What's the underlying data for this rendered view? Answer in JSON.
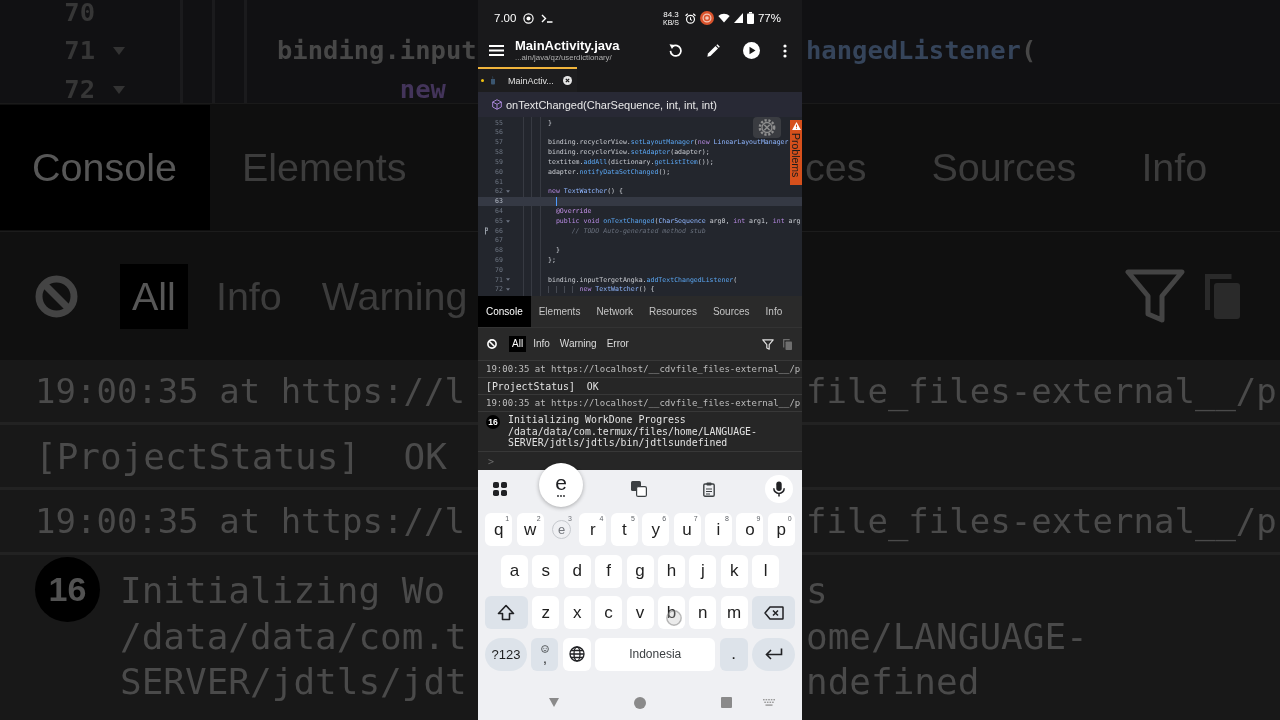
{
  "backdrop_left": {
    "code_lines": [
      {
        "number": "70",
        "foldable": false
      },
      {
        "number": "71",
        "foldable": true,
        "tokens": [
          {
            "kind": "plain",
            "text": "binding.input"
          }
        ]
      },
      {
        "number": "72",
        "foldable": true,
        "tokens": [
          {
            "kind": "keyword",
            "text": "        new"
          }
        ]
      }
    ],
    "tabs": [
      {
        "label": "Console",
        "selected": true
      },
      {
        "label": "Elements",
        "selected": false
      }
    ],
    "filters": [
      {
        "label": "All",
        "selected": true
      },
      {
        "label": "Info",
        "selected": false
      },
      {
        "label": "Warning",
        "selected": false
      }
    ],
    "log": [
      {
        "kind": "source",
        "text": "19:00:35 at https://l"
      },
      {
        "kind": "message",
        "text": "[ProjectStatus]  OK"
      },
      {
        "kind": "source",
        "text": "19:00:35 at https://l"
      },
      {
        "kind": "message",
        "count": "16",
        "lines": [
          "Initializing Wo",
          "/data/data/com.t",
          "SERVER/jdtls/jdt"
        ]
      }
    ]
  },
  "backdrop_right": {
    "code_line": {
      "tokens": [
        {
          "kind": "method",
          "text": "hangedListener"
        },
        {
          "kind": "plain",
          "text": "("
        }
      ]
    },
    "tabs": [
      {
        "label": "ces",
        "selected": false
      },
      {
        "label": "Sources",
        "selected": false
      },
      {
        "label": "Info",
        "selected": false
      }
    ],
    "log": [
      {
        "kind": "source",
        "text": "file_files-external__/p"
      },
      {
        "kind": "source",
        "text": "file_files-external__/p"
      },
      {
        "kind": "message",
        "lines": [
          "s",
          "ome/LANGUAGE-",
          "ndefined"
        ]
      }
    ]
  },
  "status_bar": {
    "time": "7.00",
    "speed": "84.3",
    "speed_unit": "KB/S",
    "battery": "77%"
  },
  "app_bar": {
    "title": "MainActivity.java",
    "subtitle": "...ain/java/qz/userdictionary/"
  },
  "file_tabs": [
    {
      "label": "MainActiv...",
      "selected": true,
      "modified": true
    }
  ],
  "breadcrumb": "onTextChanged(CharSequence, int, int, int)",
  "editor": {
    "problems_label": "Problems",
    "lines": [
      {
        "number": "55",
        "foldable": false,
        "current": false,
        "marker": false,
        "tokens": [
          {
            "kind": "plain",
            "text": "}"
          }
        ]
      },
      {
        "number": "56",
        "foldable": false,
        "current": false,
        "marker": false
      },
      {
        "number": "57",
        "foldable": false,
        "current": false,
        "marker": false,
        "tokens": [
          {
            "kind": "plain",
            "text": "binding.recyclerView."
          },
          {
            "kind": "method",
            "text": "setLayoutManager"
          },
          {
            "kind": "plain",
            "text": "("
          },
          {
            "kind": "keyword",
            "text": "new "
          },
          {
            "kind": "type",
            "text": "LinearLayoutManager"
          }
        ]
      },
      {
        "number": "58",
        "foldable": false,
        "current": false,
        "marker": false,
        "tokens": [
          {
            "kind": "plain",
            "text": "binding.recyclerView."
          },
          {
            "kind": "method",
            "text": "setAdapter"
          },
          {
            "kind": "plain",
            "text": "(adapter);"
          }
        ]
      },
      {
        "number": "59",
        "foldable": false,
        "current": false,
        "marker": false,
        "tokens": [
          {
            "kind": "plain",
            "text": "textitem."
          },
          {
            "kind": "method",
            "text": "addAll"
          },
          {
            "kind": "plain",
            "text": "(dictionary."
          },
          {
            "kind": "method",
            "text": "getListItem"
          },
          {
            "kind": "plain",
            "text": "());"
          }
        ]
      },
      {
        "number": "60",
        "foldable": false,
        "current": false,
        "marker": false,
        "tokens": [
          {
            "kind": "plain",
            "text": "adapter."
          },
          {
            "kind": "method",
            "text": "notifyDataSetChanged"
          },
          {
            "kind": "plain",
            "text": "();"
          }
        ]
      },
      {
        "number": "61",
        "foldable": false,
        "current": false,
        "marker": false
      },
      {
        "number": "62",
        "foldable": true,
        "current": false,
        "marker": false,
        "tokens": [
          {
            "kind": "keyword",
            "text": "new "
          },
          {
            "kind": "type",
            "text": "TextWatcher"
          },
          {
            "kind": "plain",
            "text": "() {"
          }
        ]
      },
      {
        "number": "63",
        "foldable": false,
        "current": true,
        "marker": false
      },
      {
        "number": "64",
        "foldable": false,
        "current": false,
        "marker": false,
        "tokens": [
          {
            "kind": "annotation",
            "text": "  @Override"
          }
        ]
      },
      {
        "number": "65",
        "foldable": true,
        "current": false,
        "marker": false,
        "tokens": [
          {
            "kind": "keyword",
            "text": "  public void "
          },
          {
            "kind": "method",
            "text": "onTextChanged"
          },
          {
            "kind": "plain",
            "text": "("
          },
          {
            "kind": "type",
            "text": "CharSequence "
          },
          {
            "kind": "plain",
            "text": "arg0, "
          },
          {
            "kind": "keyword",
            "text": "int "
          },
          {
            "kind": "plain",
            "text": "arg1, "
          },
          {
            "kind": "keyword",
            "text": "int "
          },
          {
            "kind": "plain",
            "text": "arg"
          }
        ]
      },
      {
        "number": "66",
        "foldable": false,
        "current": false,
        "marker": true,
        "tokens": [
          {
            "kind": "comment",
            "text": "      // TODO Auto-generated method stub"
          }
        ]
      },
      {
        "number": "67",
        "foldable": false,
        "current": false,
        "marker": false
      },
      {
        "number": "68",
        "foldable": false,
        "current": false,
        "marker": false,
        "tokens": [
          {
            "kind": "plain",
            "text": "  }"
          }
        ]
      },
      {
        "number": "69",
        "foldable": false,
        "current": false,
        "marker": false,
        "tokens": [
          {
            "kind": "plain",
            "text": "};"
          }
        ]
      },
      {
        "number": "70",
        "foldable": false,
        "current": false,
        "marker": false
      },
      {
        "number": "71",
        "foldable": true,
        "current": false,
        "marker": false,
        "tokens": [
          {
            "kind": "plain",
            "text": "binding.inputTergetAngka."
          },
          {
            "kind": "method",
            "text": "addTextChangedListener"
          },
          {
            "kind": "plain",
            "text": "("
          }
        ]
      },
      {
        "number": "72",
        "foldable": true,
        "current": false,
        "marker": false,
        "tokens": [
          {
            "kind": "keyword",
            "text": "        new "
          },
          {
            "kind": "type",
            "text": "TextWatcher"
          },
          {
            "kind": "plain",
            "text": "() {"
          }
        ]
      }
    ]
  },
  "devtools": {
    "tabs": [
      {
        "label": "Console",
        "selected": true
      },
      {
        "label": "Elements",
        "selected": false
      },
      {
        "label": "Network",
        "selected": false
      },
      {
        "label": "Resources",
        "selected": false
      },
      {
        "label": "Sources",
        "selected": false
      },
      {
        "label": "Info",
        "selected": false
      }
    ],
    "filters": [
      {
        "label": "All",
        "selected": true
      },
      {
        "label": "Info",
        "selected": false
      },
      {
        "label": "Warning",
        "selected": false
      },
      {
        "label": "Error",
        "selected": false
      }
    ],
    "log": [
      {
        "kind": "source",
        "text": "19:00:35 at https://localhost/__cdvfile_files-external__/p"
      },
      {
        "kind": "message",
        "text": "[ProjectStatus]  OK"
      },
      {
        "kind": "source",
        "text": "19:00:35 at https://localhost/__cdvfile_files-external__/p"
      },
      {
        "kind": "message",
        "count": "16",
        "text": "Initializing WorkDone Progress /data/data/com.termux/files/home/LANGUAGE-SERVER/jdtls/jdtls/bin/jdtlsundefined"
      }
    ],
    "prompt": ">"
  },
  "keyboard": {
    "preview": "e",
    "rows": [
      {
        "keys": [
          {
            "kind": "letter",
            "label": "q",
            "hint": "1",
            "pressed": false,
            "touched": false
          },
          {
            "kind": "letter",
            "label": "w",
            "hint": "2",
            "pressed": false,
            "touched": false
          },
          {
            "kind": "letter",
            "label": "e",
            "hint": "3",
            "pressed": true,
            "touched": false
          },
          {
            "kind": "letter",
            "label": "r",
            "hint": "4",
            "pressed": false,
            "touched": false
          },
          {
            "kind": "letter",
            "label": "t",
            "hint": "5",
            "pressed": false,
            "touched": false
          },
          {
            "kind": "letter",
            "label": "y",
            "hint": "6",
            "pressed": false,
            "touched": false
          },
          {
            "kind": "letter",
            "label": "u",
            "hint": "7",
            "pressed": false,
            "touched": false
          },
          {
            "kind": "letter",
            "label": "i",
            "hint": "8",
            "pressed": false,
            "touched": false
          },
          {
            "kind": "letter",
            "label": "o",
            "hint": "9",
            "pressed": false,
            "touched": false
          },
          {
            "kind": "letter",
            "label": "p",
            "hint": "0",
            "pressed": false,
            "touched": false
          }
        ]
      },
      {
        "keys": [
          {
            "kind": "letter",
            "label": "a",
            "pressed": false,
            "touched": false
          },
          {
            "kind": "letter",
            "label": "s",
            "pressed": false,
            "touched": false
          },
          {
            "kind": "letter",
            "label": "d",
            "pressed": false,
            "touched": false
          },
          {
            "kind": "letter",
            "label": "f",
            "pressed": false,
            "touched": false
          },
          {
            "kind": "letter",
            "label": "g",
            "pressed": false,
            "touched": false
          },
          {
            "kind": "letter",
            "label": "h",
            "pressed": false,
            "touched": false
          },
          {
            "kind": "letter",
            "label": "j",
            "pressed": false,
            "touched": false
          },
          {
            "kind": "letter",
            "label": "k",
            "pressed": false,
            "touched": false
          },
          {
            "kind": "letter",
            "label": "l",
            "pressed": false,
            "touched": false
          }
        ]
      },
      {
        "keys": [
          {
            "kind": "shift",
            "pressed": false,
            "touched": false
          },
          {
            "kind": "letter",
            "label": "z",
            "pressed": false,
            "touched": false
          },
          {
            "kind": "letter",
            "label": "x",
            "pressed": false,
            "touched": false
          },
          {
            "kind": "letter",
            "label": "c",
            "pressed": false,
            "touched": false
          },
          {
            "kind": "letter",
            "label": "v",
            "pressed": false,
            "touched": false
          },
          {
            "kind": "letter",
            "label": "b",
            "pressed": false,
            "touched": true
          },
          {
            "kind": "letter",
            "label": "n",
            "pressed": false,
            "touched": false
          },
          {
            "kind": "letter",
            "label": "m",
            "pressed": false,
            "touched": false
          },
          {
            "kind": "backspace",
            "pressed": false,
            "touched": false
          }
        ]
      },
      {
        "keys": [
          {
            "kind": "symbols",
            "label": "?123",
            "pressed": false,
            "touched": false
          },
          {
            "kind": "emoji_comma",
            "label": ",",
            "pressed": false,
            "touched": false
          },
          {
            "kind": "globe",
            "pressed": false,
            "touched": false
          },
          {
            "kind": "space",
            "label": "Indonesia",
            "pressed": false,
            "touched": false
          },
          {
            "kind": "period",
            "label": ".",
            "pressed": false,
            "touched": false
          },
          {
            "kind": "enter",
            "pressed": false,
            "touched": false
          }
        ]
      }
    ]
  }
}
